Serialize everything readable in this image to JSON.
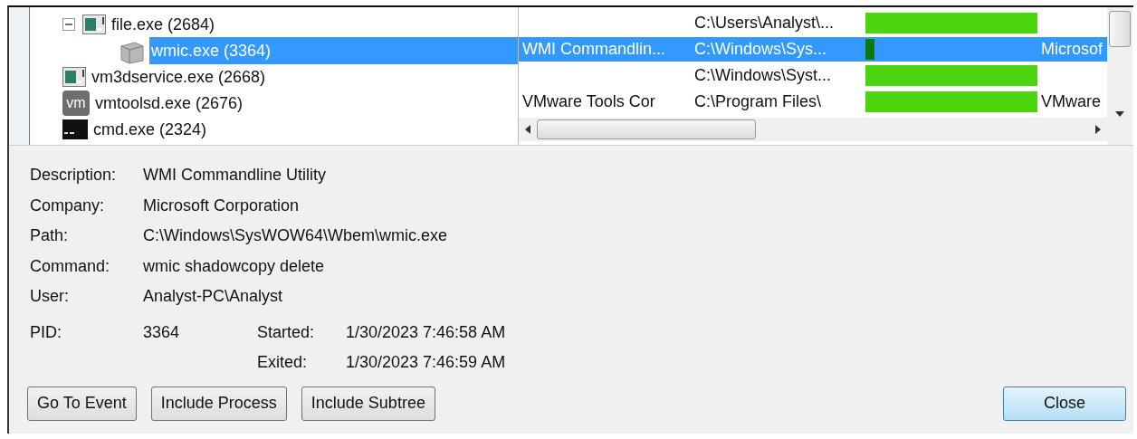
{
  "processes": [
    {
      "name": "file.exe (2684)",
      "kind": "app",
      "expanded": true,
      "selected": false,
      "path": "C:\\Users\\Analyst\\...",
      "level": 1,
      "children": [
        {
          "name": "wmic.exe (3364)",
          "kind": "wmic",
          "selected": true,
          "description": "WMI Commandlin...",
          "path": "C:\\Windows\\Sys...",
          "level": 0.05,
          "company": "Microsof"
        }
      ]
    },
    {
      "name": "vm3dservice.exe (2668)",
      "kind": "app",
      "selected": false,
      "path": "C:\\Windows\\Syst...",
      "level": 1
    },
    {
      "name": "vmtoolsd.exe (2676)",
      "kind": "vm",
      "icon_text": "vm",
      "selected": false,
      "description": "VMware Tools Cor",
      "path": "C:\\Program Files\\",
      "level": 1,
      "company": "VMware"
    },
    {
      "name": "cmd.exe (2324)",
      "kind": "cmd",
      "selected": false
    }
  ],
  "details": [
    {
      "label": "Description:",
      "value": "WMI Commandline Utility"
    },
    {
      "label": "Company:",
      "value": "Microsoft Corporation"
    },
    {
      "label": "Path:",
      "value": "C:\\Windows\\SysWOW64\\Wbem\\wmic.exe"
    },
    {
      "label": "Command:",
      "value": "wmic shadowcopy delete"
    },
    {
      "label": "User:",
      "value": "Analyst-PC\\Analyst"
    }
  ],
  "pid": {
    "label": "PID:",
    "value": "3364"
  },
  "times": [
    {
      "label": "Started:",
      "value": "1/30/2023 7:46:58 AM"
    },
    {
      "label": "Exited:",
      "value": "1/30/2023 7:46:59 AM"
    }
  ],
  "buttons": [
    {
      "label": "Go To Event",
      "default": false
    },
    {
      "label": "Include Process",
      "default": false
    },
    {
      "label": "Include Subtree",
      "default": false
    },
    {
      "label": "Close",
      "default": true
    }
  ]
}
